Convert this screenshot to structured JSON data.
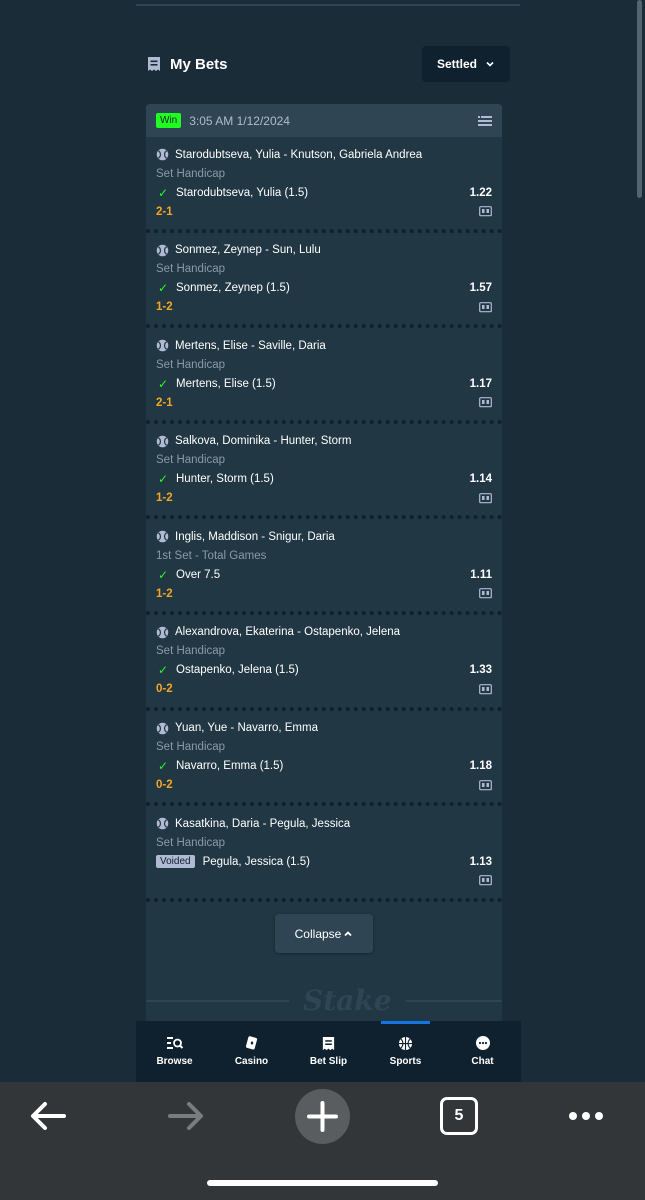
{
  "header": {
    "title": "My Bets",
    "filter_label": "Settled"
  },
  "card": {
    "status": "Win",
    "time": "3:05 AM 1/12/2024",
    "legs": [
      {
        "match": "Starodubtseva, Yulia - Knutson, Gabriela Andrea",
        "market": "Set Handicap",
        "selection": "Starodubtseva, Yulia (1.5)",
        "odds": "1.22",
        "score": "2-1",
        "result": "won"
      },
      {
        "match": "Sonmez, Zeynep - Sun, Lulu",
        "market": "Set Handicap",
        "selection": "Sonmez, Zeynep (1.5)",
        "odds": "1.57",
        "score": "1-2",
        "result": "won"
      },
      {
        "match": "Mertens, Elise - Saville, Daria",
        "market": "Set Handicap",
        "selection": "Mertens, Elise (1.5)",
        "odds": "1.17",
        "score": "2-1",
        "result": "won"
      },
      {
        "match": "Salkova, Dominika - Hunter, Storm",
        "market": "Set Handicap",
        "selection": "Hunter, Storm (1.5)",
        "odds": "1.14",
        "score": "1-2",
        "result": "won"
      },
      {
        "match": "Inglis, Maddison - Snigur, Daria",
        "market": "1st Set - Total Games",
        "selection": "Over 7.5",
        "odds": "1.11",
        "score": "1-2",
        "result": "won"
      },
      {
        "match": "Alexandrova, Ekaterina - Ostapenko, Jelena",
        "market": "Set Handicap",
        "selection": "Ostapenko, Jelena (1.5)",
        "odds": "1.33",
        "score": "0-2",
        "result": "won"
      },
      {
        "match": "Yuan, Yue - Navarro, Emma",
        "market": "Set Handicap",
        "selection": "Navarro, Emma (1.5)",
        "odds": "1.18",
        "score": "0-2",
        "result": "won"
      },
      {
        "match": "Kasatkina, Daria - Pegula, Jessica",
        "market": "Set Handicap",
        "selection": "Pegula, Jessica (1.5)",
        "odds": "1.13",
        "score": "",
        "result": "voided",
        "badge": "Voided"
      }
    ],
    "collapse_label": "Collapse",
    "logo_text": "Stake"
  },
  "nav": {
    "items": [
      {
        "label": "Browse",
        "icon": "browse-icon"
      },
      {
        "label": "Casino",
        "icon": "casino-icon"
      },
      {
        "label": "Bet Slip",
        "icon": "bet-slip-icon"
      },
      {
        "label": "Sports",
        "icon": "sports-icon",
        "active": true
      },
      {
        "label": "Chat",
        "icon": "chat-icon"
      }
    ]
  },
  "browser": {
    "tab_count": "5"
  },
  "colors": {
    "bg": "#1a2c38",
    "card": "#213743",
    "win": "#1fff20",
    "score": "#f5a623",
    "active": "#1475e1"
  }
}
